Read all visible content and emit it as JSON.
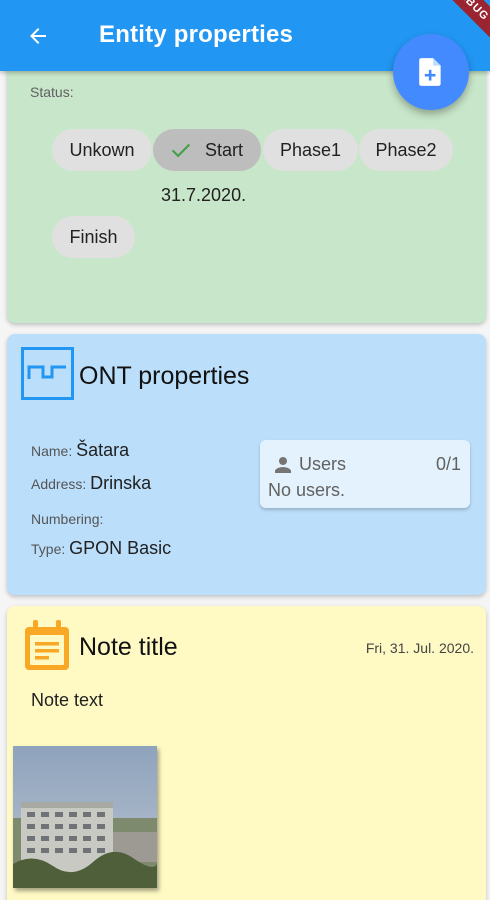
{
  "app_bar": {
    "title": "Entity properties",
    "back_icon": "arrow-back-icon",
    "background": "#2196f3",
    "debug_banner": "DEBUG"
  },
  "fab": {
    "icon": "note-add-icon",
    "color": "#448aff"
  },
  "status_card": {
    "label": "Status:",
    "chips": [
      {
        "label": "Unkown",
        "selected": false
      },
      {
        "label": "Start",
        "selected": true
      },
      {
        "label": "Phase1",
        "selected": false
      },
      {
        "label": "Phase2",
        "selected": false
      },
      {
        "label": "Finish",
        "selected": false
      }
    ],
    "selected_date": "31.7.2020.",
    "background": "#c8e6c9"
  },
  "ont_card": {
    "title": "ONT properties",
    "icon": "ont-device-icon",
    "properties": [
      {
        "label": "Name:",
        "value": "Šatara"
      },
      {
        "label": "Address:",
        "value": "Drinska"
      },
      {
        "label": "Numbering:",
        "value": ""
      },
      {
        "label": "Type:",
        "value": "GPON Basic"
      }
    ],
    "users": {
      "label": "Users",
      "count": "0/1",
      "empty_text": "No users."
    },
    "background": "#bbdefb"
  },
  "note_card": {
    "title": "Note title",
    "date": "Fri, 31. Jul. 2020.",
    "text": "Note text",
    "icon": "calendar-note-icon",
    "photo_icon": "building-photo",
    "background": "#fff9c4"
  }
}
